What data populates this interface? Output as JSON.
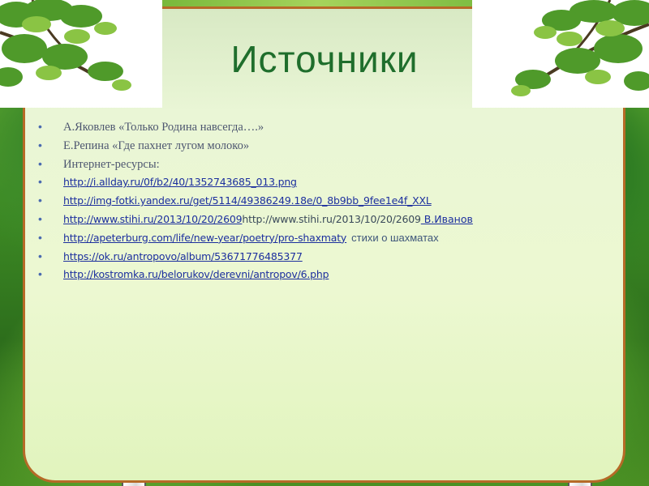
{
  "slide": {
    "title": "Источники",
    "items": [
      {
        "text": "А.Яковлев «Только Родина навсегда….»"
      },
      {
        "text": "Е.Репина «Где пахнет лугом молоко»"
      },
      {
        "text": "Интернет-ресурсы:"
      },
      {
        "link": "http://i.allday.ru/0f/b2/40/1352743685_013.png"
      },
      {
        "link": "http://img-fotki.yandex.ru/get/5114/49386249.18e/0_8b9bb_9fee1e4f_XXL"
      },
      {
        "link": "http://www.stihi.ru/2013/10/20/2609",
        "plain": "http://www.stihi.ru/2013/10/20/2609",
        "plainlink": " В.Иванов"
      },
      {
        "link": "http://apeterburg.com/life/new-year/poetry/pro-shaxmaty",
        "note": "стихи о шахматах"
      },
      {
        "link": "https://ok.ru/antropovo/album/53671776485377"
      },
      {
        "link": "http://kostromka.ru/belorukov/derevni/antropov/6.php"
      }
    ]
  }
}
